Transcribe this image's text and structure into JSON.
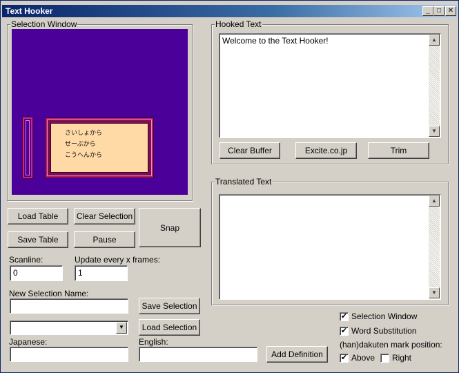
{
  "window": {
    "title": "Text Hooker",
    "minimize_glyph": "_",
    "maximize_glyph": "□",
    "close_glyph": "✕"
  },
  "selection_window": {
    "label": "Selection Window",
    "menu_lines": [
      "さいしょから",
      "せーぶから",
      "こうへんから"
    ],
    "colors": {
      "background": "#4b0099",
      "menu_fill": "#ffd9a6",
      "frame": "#b3206f"
    }
  },
  "hooked_text": {
    "label": "Hooked Text",
    "content": "Welcome to the Text Hooker!",
    "buttons": {
      "clear_buffer": "Clear Buffer",
      "excite": "Excite.co.jp",
      "trim": "Trim"
    }
  },
  "translated_text": {
    "label": "Translated Text",
    "content": ""
  },
  "controls": {
    "load_table": "Load Table",
    "clear_selection": "Clear Selection",
    "snap": "Snap",
    "save_table": "Save Table",
    "pause": "Pause",
    "scanline_label": "Scanline:",
    "scanline_value": "0",
    "update_label": "Update every x frames:",
    "update_value": "1",
    "new_selection_label": "New Selection Name:",
    "new_selection_value": "",
    "save_selection": "Save Selection",
    "selection_dropdown_value": "",
    "load_selection": "Load Selection",
    "japanese_label": "Japanese:",
    "japanese_value": "",
    "english_label": "English:",
    "english_value": "",
    "add_definition": "Add Definition"
  },
  "options": {
    "selection_window": {
      "label": "Selection Window",
      "checked": true
    },
    "word_substitution": {
      "label": "Word Substitution",
      "checked": true
    },
    "dakuten_label": "(han)dakuten mark position:",
    "above": {
      "label": "Above",
      "checked": true
    },
    "right": {
      "label": "Right",
      "checked": false
    }
  },
  "glyphs": {
    "up": "▲",
    "down": "▼",
    "check": "✔"
  }
}
